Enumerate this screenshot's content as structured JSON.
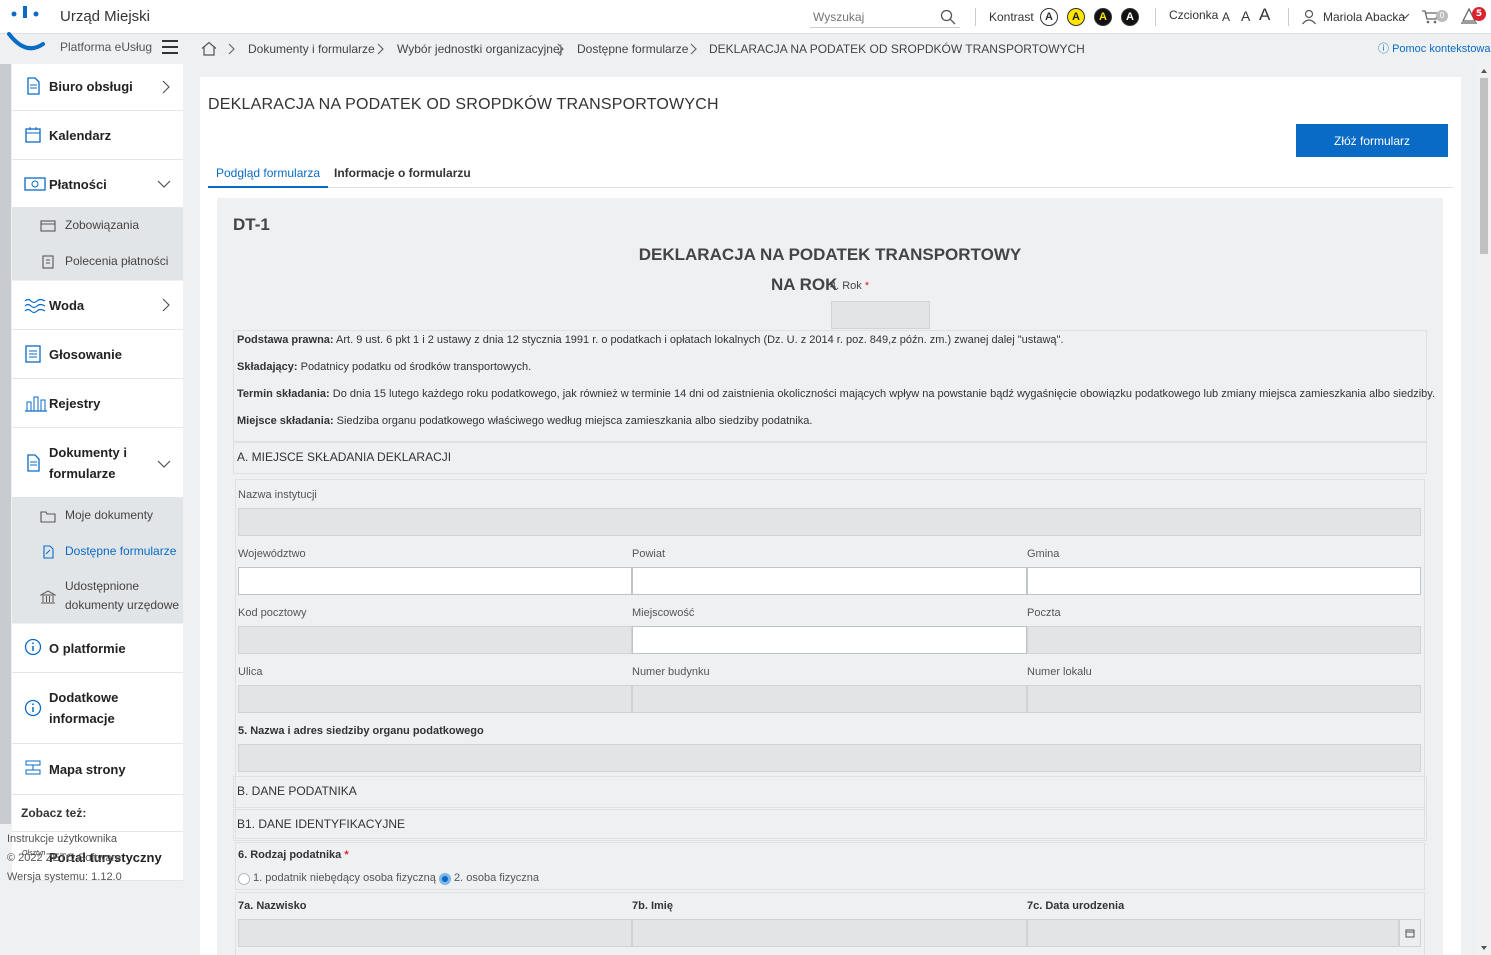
{
  "app": {
    "title": "Urząd Miejski",
    "subtitle": "Platforma eUsług"
  },
  "topbar": {
    "search_placeholder": "Wyszukaj",
    "contrast_label": "Kontrast",
    "contrast_options": [
      "A",
      "A",
      "A",
      "A"
    ],
    "font_label": "Czcionka",
    "font_sizes": [
      "A",
      "A",
      "A"
    ],
    "user_name": "Mariola Abacka",
    "cart_count": "0",
    "notification_count": "5"
  },
  "breadcrumb": {
    "items": [
      "Dokumenty i formularze",
      "Wybór jednostki organizacyjnej",
      "Dostępne formularze",
      "DEKLARACJA NA PODATEK OD SROPDKÓW TRANSPORTOWYCH"
    ],
    "help": "Pomoc kontekstowa"
  },
  "sidebar": {
    "items": [
      {
        "label": "Biuro obsługi"
      },
      {
        "label": "Kalendarz"
      },
      {
        "label": "Płatności"
      },
      {
        "label": "Woda"
      },
      {
        "label": "Głosowanie"
      },
      {
        "label": "Rejestry"
      },
      {
        "label": "Dokumenty i formularze"
      },
      {
        "label": "O platformie"
      },
      {
        "label": "Dodatkowe informacje"
      },
      {
        "label": "Mapa strony"
      }
    ],
    "payments_sub": [
      "Zobowiązania",
      "Polecenia płatności"
    ],
    "documents_sub": [
      "Moje dokumenty",
      "Dostępne formularze",
      "Udostępnione dokumenty urzędowe"
    ],
    "see_also": "Zobacz też:",
    "portal_logo_text": "Olsztyn",
    "portal": "Portal turystyczny",
    "footer": [
      "Instrukcje użytkownika",
      "© 2022 ZETO Software",
      "Wersja systemu: 1.12.0"
    ]
  },
  "main": {
    "title": "DEKLARACJA NA PODATEK OD SROPDKÓW TRANSPORTOWYCH",
    "submit_label": "Złóż formularz",
    "tabs": [
      "Podgląd formularza",
      "Informacje o formularzu"
    ]
  },
  "form": {
    "code": "DT-1",
    "heading": "DEKLARACJA NA PODATEK TRANSPORTOWY",
    "year_heading": "NA ROK",
    "year_label": "4. Rok",
    "legal": [
      {
        "bold": "Podstawa prawna:",
        "text": " Art. 9 ust. 6 pkt 1 i 2 ustawy z dnia 12 stycznia 1991 r. o podatkach i opłatach lokalnych (Dz. U. z 2014 r. poz. 849,z późn. zm.) zwanej dalej \"ustawą\"."
      },
      {
        "bold": "Składający:",
        "text": " Podatnicy podatku od środków transportowych."
      },
      {
        "bold": "Termin składania:",
        "text": " Do dnia 15 lutego każdego roku podatkowego, jak również w terminie 14 dni od zaistnienia okoliczności mających wpływ na powstanie bądź wygaśnięcie obowiązku podatkowego lub zmiany miejsca zamieszkania albo siedziby."
      },
      {
        "bold": "Miejsce składania:",
        "text": " Siedziba organu podatkowego właściwego według miejsca zamieszkania albo siedziby podatnika."
      }
    ],
    "section_a": "A. MIEJSCE SKŁADANIA DEKLARACJI",
    "institution_label": "Nazwa instytucji",
    "address_labels": [
      "Województwo",
      "Powiat",
      "Gmina",
      "Kod pocztowy",
      "Miejscowość",
      "Poczta",
      "Ulica",
      "Numer budynku",
      "Numer lokalu"
    ],
    "tax_office_label": "5. Nazwa i adres siedziby organu podatkowego",
    "section_b": "B. DANE PODATNIKA",
    "section_b1": "B1. DANE IDENTYFIKACYJNE",
    "taxpayer_type_label": "6. Rodzaj podatnika",
    "taxpayer_type_options": [
      "1. podatnik niebędący osoba fizyczną",
      "2. osoba fizyczna"
    ],
    "taxpayer_type_selected": 1,
    "person_labels": [
      "7a. Nazwisko",
      "7b. Imię",
      "7c. Data urodzenia"
    ]
  },
  "colors": {
    "accent": "#0a6bc7",
    "required": "#d9232e"
  }
}
